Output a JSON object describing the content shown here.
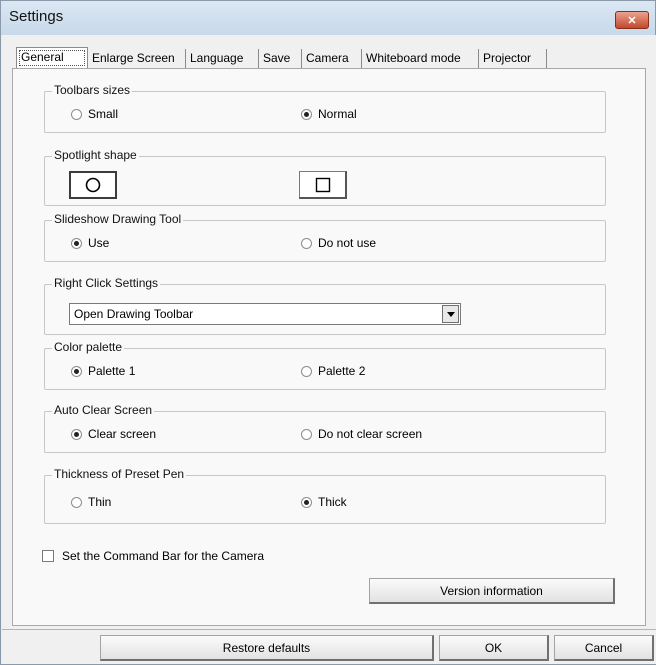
{
  "window": {
    "title": "Settings",
    "close_glyph": "✕"
  },
  "tabs": [
    {
      "label": "General"
    },
    {
      "label": "Enlarge Screen"
    },
    {
      "label": "Language"
    },
    {
      "label": "Save"
    },
    {
      "label": "Camera"
    },
    {
      "label": "Whiteboard mode"
    },
    {
      "label": "Projector"
    }
  ],
  "active_tab": "General",
  "groups": {
    "toolbar_sizes": {
      "title": "Toolbars sizes",
      "options": [
        "Small",
        "Normal"
      ],
      "selected": "Normal"
    },
    "spotlight_shape": {
      "title": "Spotlight shape",
      "options": [
        "circle-icon",
        "square-icon"
      ],
      "selected": "circle-icon"
    },
    "slideshow_tool": {
      "title": "Slideshow Drawing Tool",
      "options": [
        "Use",
        "Do not use"
      ],
      "selected": "Use"
    },
    "right_click": {
      "title": "Right Click Settings",
      "value": "Open Drawing Toolbar"
    },
    "color_palette": {
      "title": "Color palette",
      "options": [
        "Palette 1",
        "Palette 2"
      ],
      "selected": "Palette 1"
    },
    "auto_clear": {
      "title": "Auto Clear Screen",
      "options": [
        "Clear screen",
        "Do not clear screen"
      ],
      "selected": "Clear screen"
    },
    "pen_thickness": {
      "title": "Thickness of Preset Pen",
      "options": [
        "Thin",
        "Thick"
      ],
      "selected": "Thick"
    }
  },
  "command_bar_checkbox": {
    "label": "Set the Command Bar for the Camera",
    "checked": false
  },
  "buttons": {
    "version": "Version information",
    "restore": "Restore defaults",
    "ok": "OK",
    "cancel": "Cancel"
  }
}
